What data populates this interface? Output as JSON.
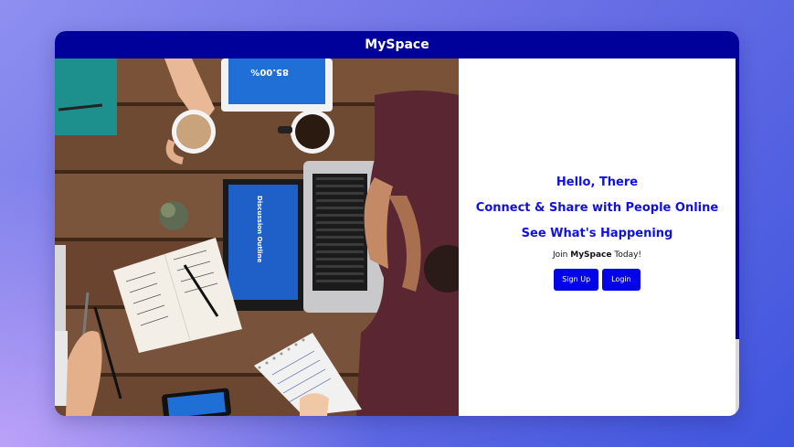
{
  "app": {
    "title": "MySpace"
  },
  "hero": {
    "image": "people-working-laptop-desk-photo",
    "greeting": "Hello, There",
    "tagline": "Connect & Share with People Online",
    "subtagline": "See What's Happening",
    "join_prefix": "Join",
    "join_brand": "MySpace",
    "join_suffix": "Today!",
    "tablet_text": "85.00%",
    "laptop_text": "Discussion Outline"
  },
  "actions": {
    "signup_label": "Sign Up",
    "login_label": "Login"
  },
  "colors": {
    "header": "#00009a",
    "accent": "#0404e8",
    "text_accent": "#1010e0"
  }
}
